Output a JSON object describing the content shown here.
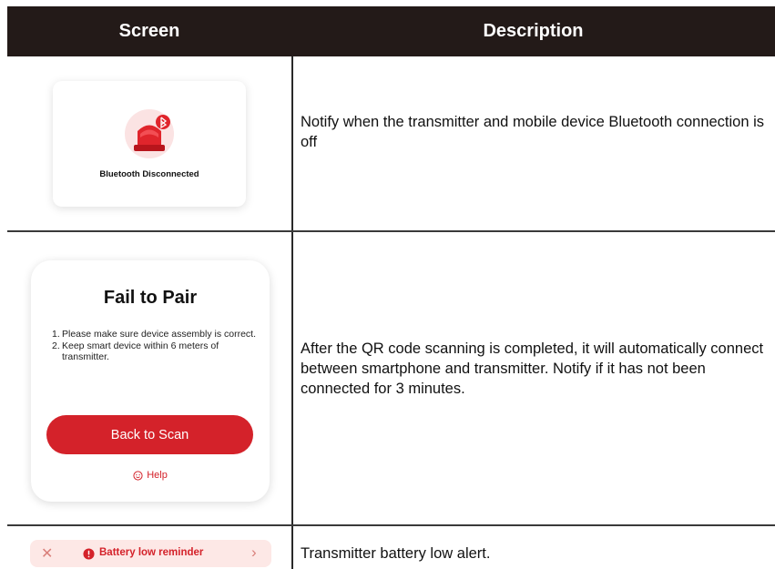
{
  "table": {
    "header_screen": "Screen",
    "header_description": "Description"
  },
  "rows": [
    {
      "card_label": "Bluetooth Disconnected",
      "description": "Notify when the transmitter and mobile device Bluetooth connection is off"
    },
    {
      "card_title": "Fail to Pair",
      "items": [
        {
          "num": "1.",
          "text": "Please make sure device assembly is correct."
        },
        {
          "num": "2.",
          "text": "Keep smart device within 6 meters of transmitter."
        }
      ],
      "button_label": "Back to Scan",
      "help_label": "Help",
      "description": "After the QR code scanning is completed, it will automatically connect between smartphone and transmitter. Notify if it has not been connected for 3 minutes."
    },
    {
      "banner_label": "Battery low reminder",
      "description": "Transmitter battery low alert."
    }
  ],
  "colors": {
    "header_bg": "#231a18",
    "accent_red": "#d4222a",
    "banner_bg": "#fde8e6"
  },
  "icons": [
    "siren-bluetooth-icon",
    "help-smiley-icon",
    "close-icon",
    "warning-icon",
    "chevron-right-icon"
  ]
}
